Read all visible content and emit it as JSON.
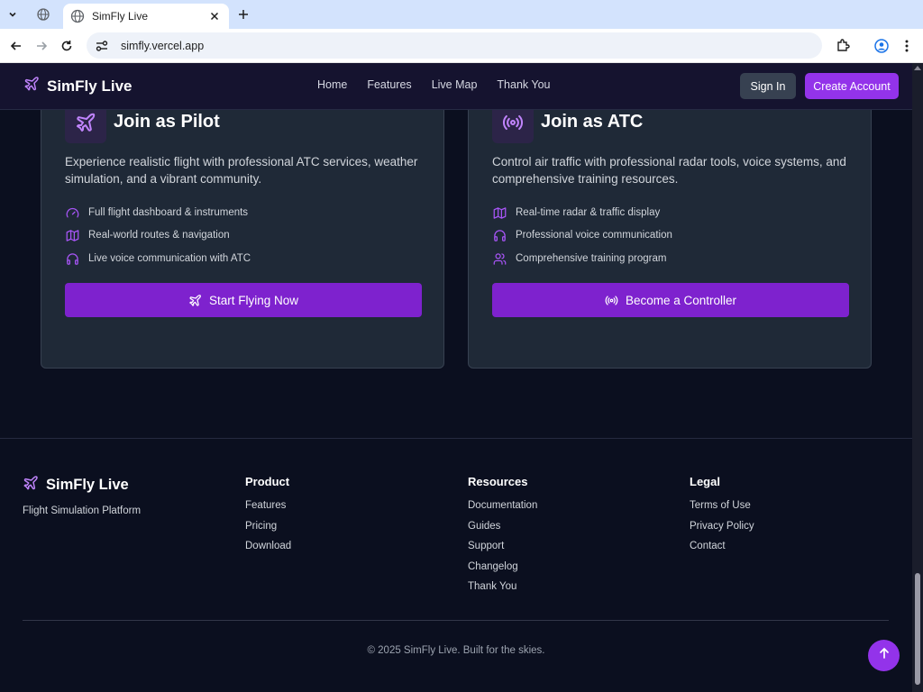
{
  "browser": {
    "tab_title": "SimFly Live",
    "url": "simfly.vercel.app"
  },
  "header": {
    "brand": "SimFly Live",
    "nav": [
      "Home",
      "Features",
      "Live Map",
      "Thank You"
    ],
    "sign_in": "Sign In",
    "create_account": "Create Account"
  },
  "pilot": {
    "title": "Join as Pilot",
    "description": "Experience realistic flight with professional ATC services, weather simulation, and a vibrant community.",
    "features": [
      {
        "icon": "gauge-icon",
        "text": "Full flight dashboard & instruments"
      },
      {
        "icon": "map-icon",
        "text": "Real-world routes & navigation"
      },
      {
        "icon": "headphones-icon",
        "text": "Live voice communication with ATC"
      }
    ],
    "button": "Start Flying Now"
  },
  "atc": {
    "title": "Join as ATC",
    "description": "Control air traffic with professional radar tools, voice systems, and comprehensive training resources.",
    "features": [
      {
        "icon": "map-icon",
        "text": "Real-time radar & traffic display"
      },
      {
        "icon": "headphones-icon",
        "text": "Professional voice communication"
      },
      {
        "icon": "users-icon",
        "text": "Comprehensive training program"
      }
    ],
    "button": "Become a Controller"
  },
  "footer": {
    "brand": "SimFly Live",
    "tagline": "Flight Simulation Platform",
    "columns": [
      {
        "heading": "Product",
        "links": [
          "Features",
          "Pricing",
          "Download"
        ]
      },
      {
        "heading": "Resources",
        "links": [
          "Documentation",
          "Guides",
          "Support",
          "Changelog",
          "Thank You"
        ]
      },
      {
        "heading": "Legal",
        "links": [
          "Terms of Use",
          "Privacy Policy",
          "Contact"
        ]
      }
    ],
    "copyright": "© 2025 SimFly Live. Built for the skies."
  },
  "colors": {
    "accent": "#9333ea",
    "button": "#7e22ce",
    "card_bg": "#1f2937",
    "page_bg": "#0b0f1f"
  }
}
